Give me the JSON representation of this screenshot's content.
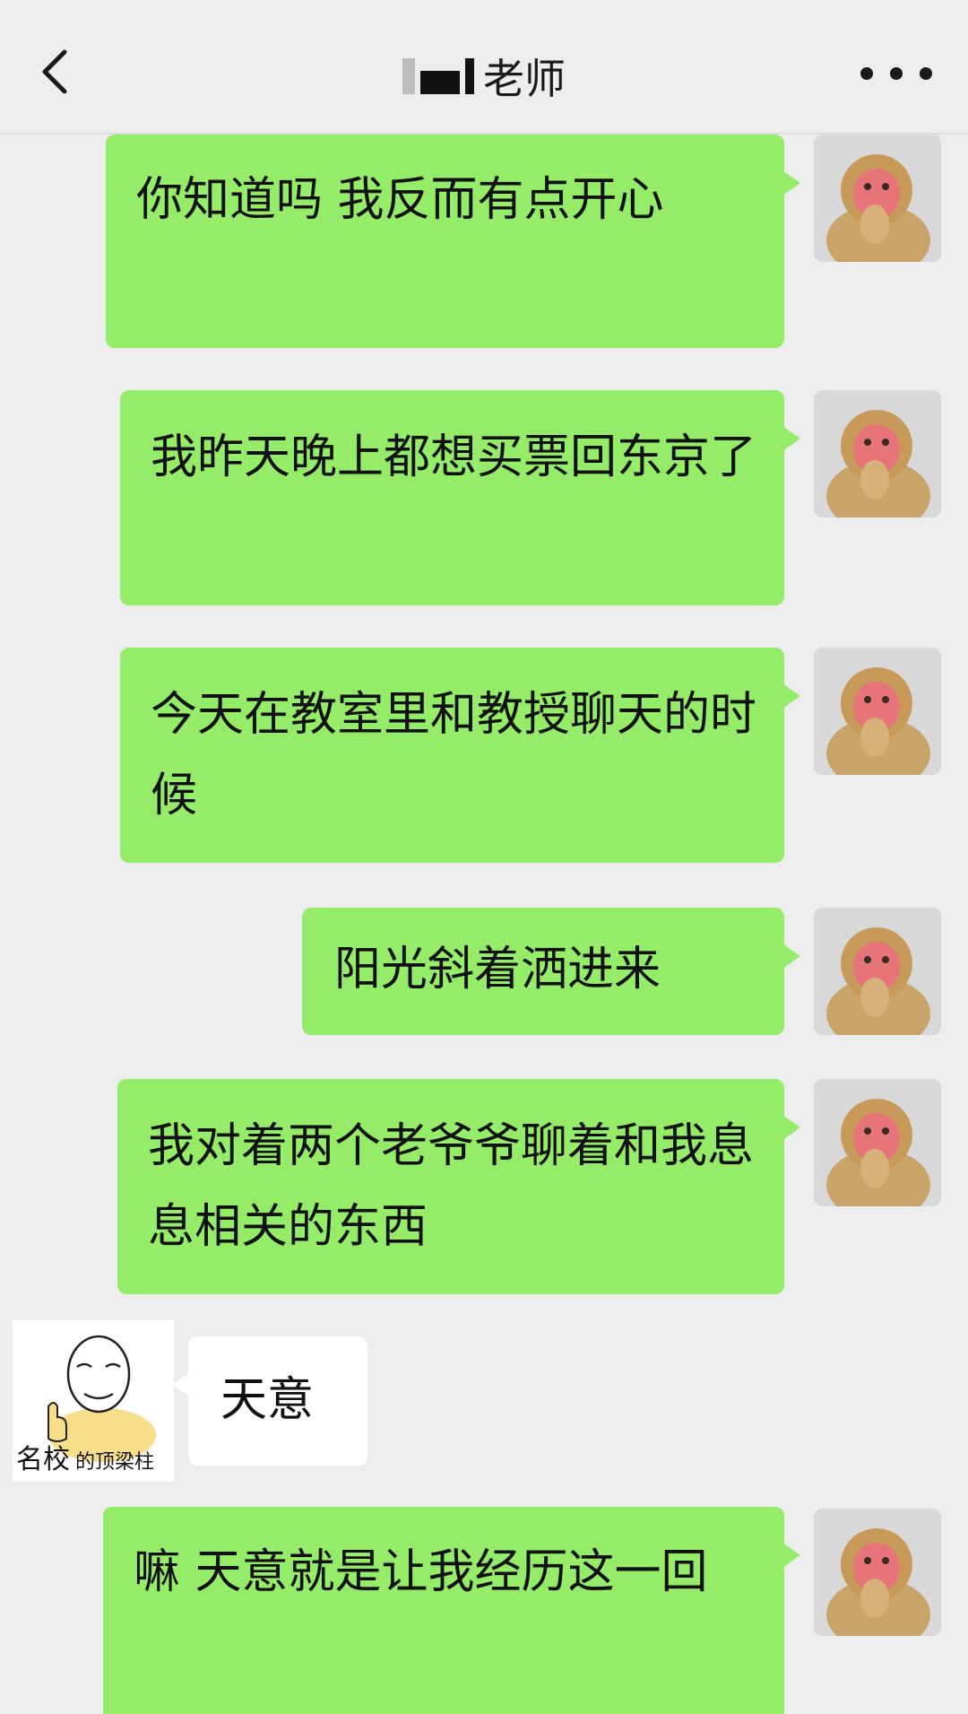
{
  "header": {
    "title": "老师",
    "back_icon": "chevron-left-icon",
    "more_icon": "more-dots-icon"
  },
  "messages": [
    {
      "side": "right",
      "text": "你知道吗 我反而有点开心"
    },
    {
      "side": "right",
      "text": "我昨天晚上都想买票回东京了"
    },
    {
      "side": "right",
      "text": "今天在教室里和教授聊天的时候"
    },
    {
      "side": "right",
      "text": "阳光斜着洒进来"
    },
    {
      "side": "right",
      "text": "我对着两个老爷爷聊着和我息息相关的东西"
    },
    {
      "side": "left",
      "text": "天意"
    },
    {
      "side": "right",
      "text": "嘛 天意就是让我经历这一回"
    }
  ],
  "meme": {
    "caption_big": "名校",
    "caption_small": "的顶梁柱"
  },
  "colors": {
    "background": "#ededed",
    "bubble_self": "#95ec69",
    "bubble_other": "#ffffff"
  }
}
